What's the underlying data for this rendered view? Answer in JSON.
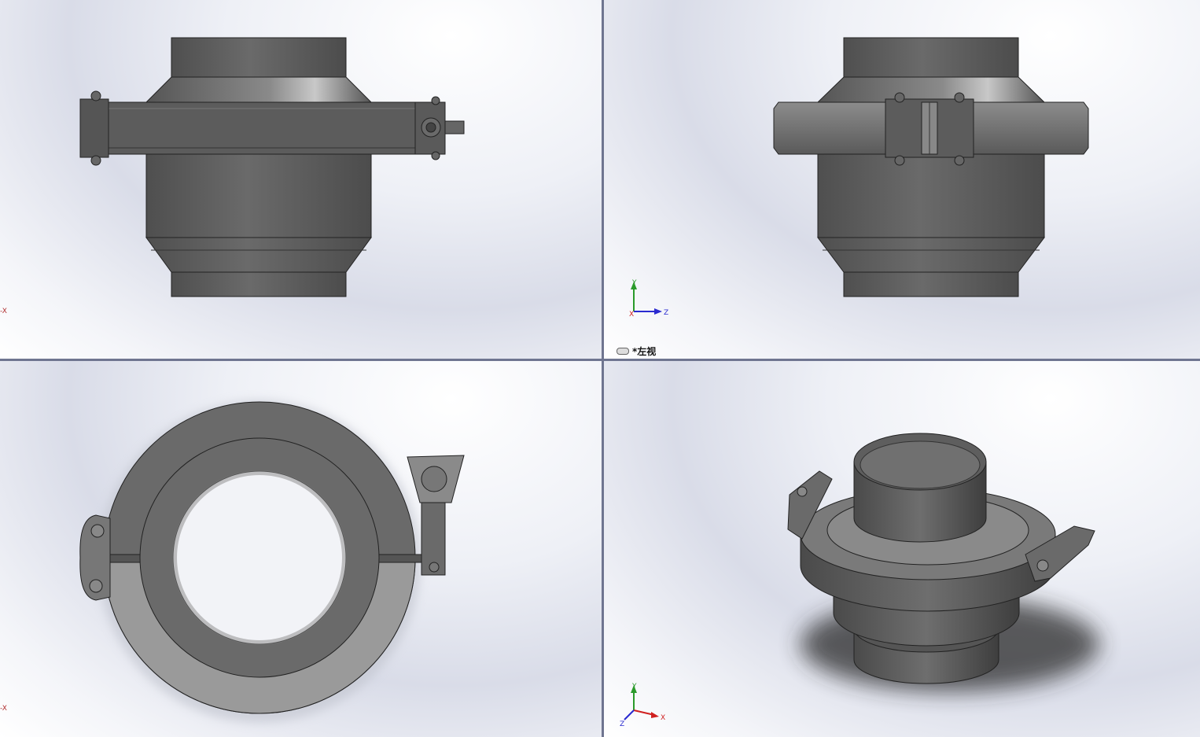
{
  "viewports": {
    "top_left": {
      "axis_stub": "-X"
    },
    "top_right": {
      "view_name": "*左视",
      "triad": {
        "y": "Y",
        "z": "Z",
        "x": "X"
      }
    },
    "bottom_left": {
      "axis_stub": "-X"
    },
    "bottom_right": {
      "triad": {
        "y": "Y",
        "z": "Z",
        "x": "X"
      }
    }
  },
  "colors": {
    "model_dark": "#5a5a5a",
    "model_mid": "#6e6e6e",
    "model_light": "#9a9a9a",
    "divider": "#6f7590",
    "triad_y": "#2a9a2a",
    "triad_z": "#2a2ad0",
    "triad_x": "#d02020"
  }
}
